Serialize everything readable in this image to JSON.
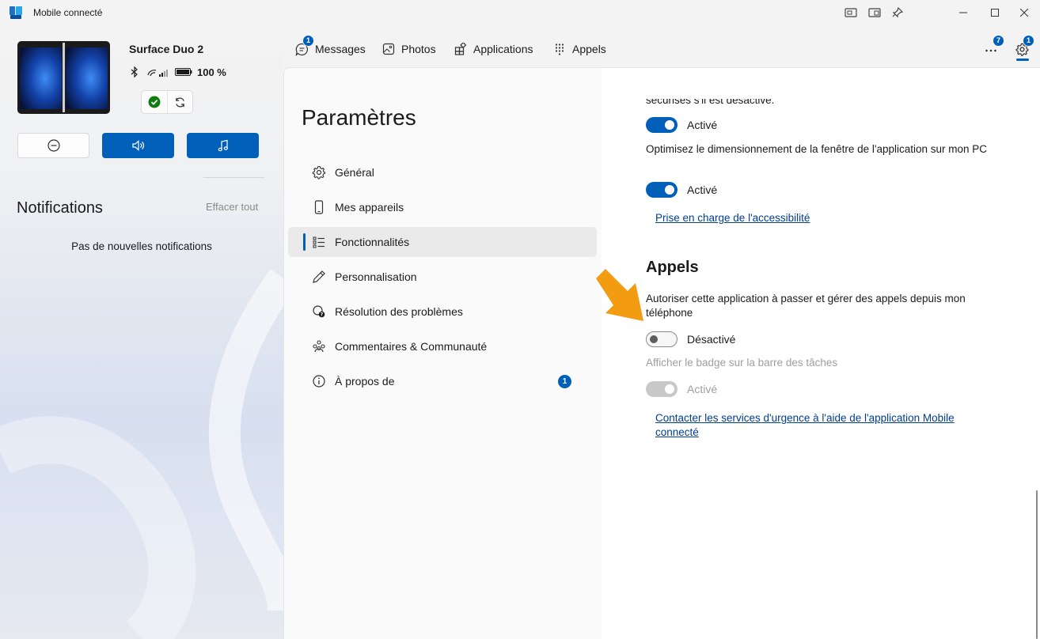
{
  "window": {
    "title": "Mobile connecté"
  },
  "device": {
    "name": "Surface Duo 2",
    "battery": "100 %"
  },
  "notifications": {
    "title": "Notifications",
    "clear_all": "Effacer tout",
    "empty": "Pas de nouvelles notifications"
  },
  "nav": {
    "tabs": [
      {
        "label": "Messages",
        "badge": "1"
      },
      {
        "label": "Photos"
      },
      {
        "label": "Applications"
      },
      {
        "label": "Appels"
      }
    ],
    "more_badge": "7",
    "settings_badge": "1"
  },
  "settings": {
    "title": "Paramètres",
    "items": [
      {
        "label": "Général",
        "icon": "gear-icon"
      },
      {
        "label": "Mes appareils",
        "icon": "phone-icon"
      },
      {
        "label": "Fonctionnalités",
        "icon": "feature-list-icon"
      },
      {
        "label": "Personnalisation",
        "icon": "pen-icon"
      },
      {
        "label": "Résolution des problèmes",
        "icon": "troubleshoot-icon"
      },
      {
        "label": "Commentaires & Communauté",
        "icon": "community-icon"
      },
      {
        "label": "À propos de",
        "icon": "info-icon",
        "badge": "1"
      }
    ]
  },
  "content": {
    "cut_text": "sécurisés s'il est désactivé.",
    "toggle1_label": "Activé",
    "optimize_desc": "Optimisez le dimensionnement de la fenêtre de l'application sur mon PC",
    "toggle2_label": "Activé",
    "accessibility_link": "Prise en charge de l'accessibilité",
    "calls_heading": "Appels",
    "calls_desc": "Autoriser cette application à passer et gérer des appels depuis mon téléphone",
    "calls_toggle_label": "Désactivé",
    "badge_desc": "Afficher le badge sur la barre des tâches",
    "badge_toggle_label": "Activé",
    "emergency_link": "Contacter les services d'urgence à l'aide de l'application Mobile connecté"
  },
  "colors": {
    "accent": "#005fb8",
    "arrow": "#f39c12",
    "link": "#003e92"
  }
}
